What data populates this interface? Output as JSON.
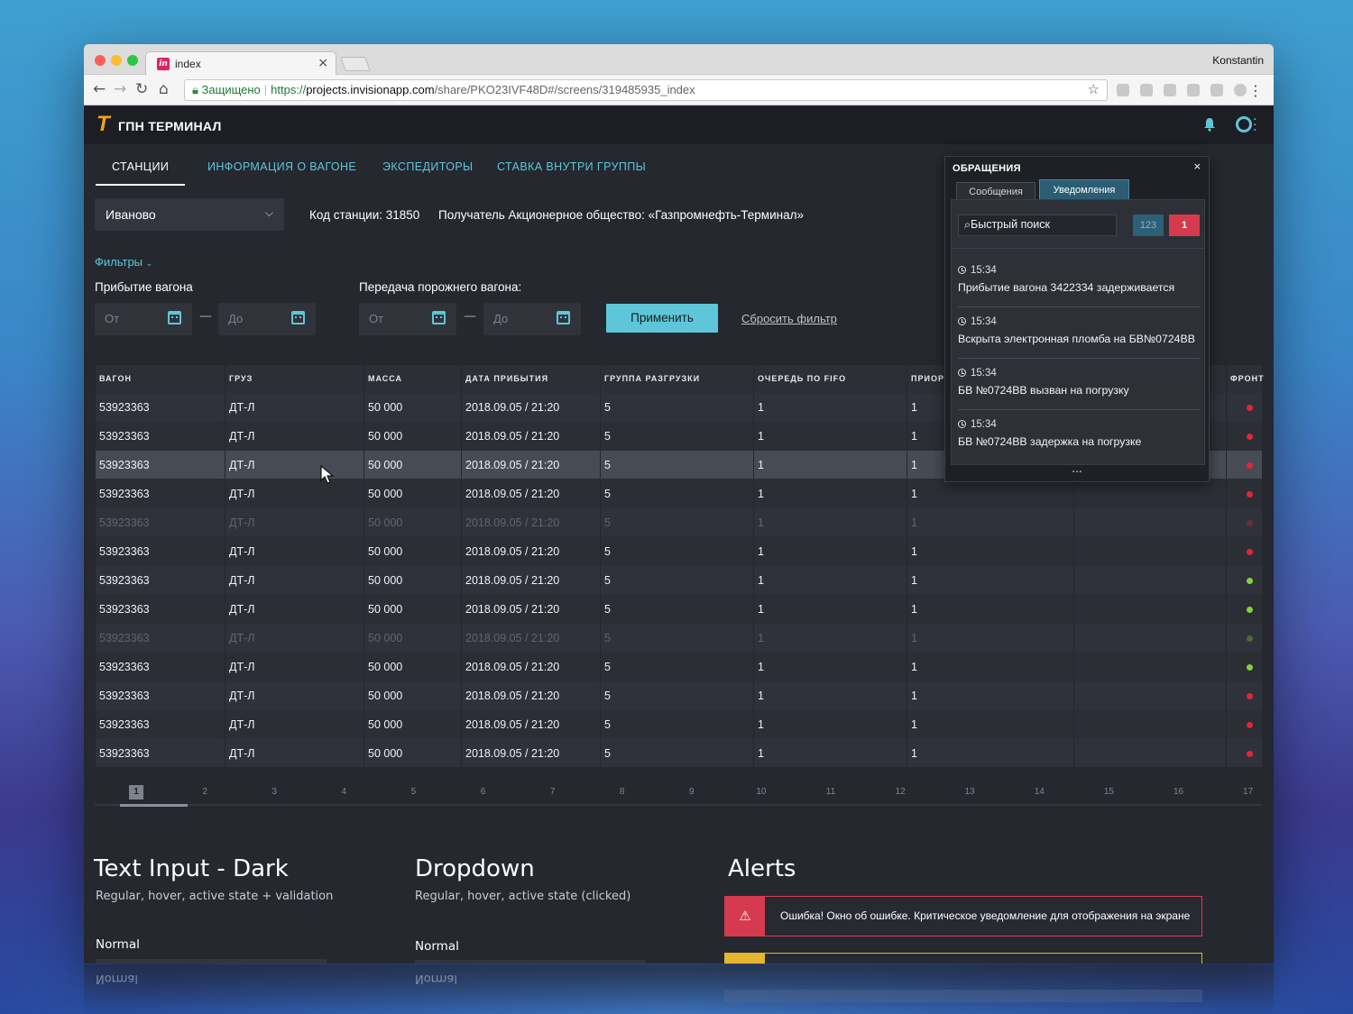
{
  "browser": {
    "tab_title": "index",
    "favicon_text": "in",
    "profile_name": "Konstantin",
    "url_secure_label": "Защищено",
    "url_protocol": "https://",
    "url_host": "projects.invisionapp.com",
    "url_path": "/share/PKO23IVF48D#/screens/319485935_index"
  },
  "header": {
    "logo_letter": "T",
    "brand": "ГПН ТЕРМИНАЛ"
  },
  "nav_tabs": [
    "СТАНЦИИ",
    "ИНФОРМАЦИЯ О ВАГОНЕ",
    "ЭКСПЕДИТОРЫ",
    "СТАВКА ВНУТРИ ГРУППЫ"
  ],
  "station": {
    "selected": "Иваново",
    "code_label": "Код станции: 31850",
    "receiver_label": "Получатель Акционерное общество: «Газпромнефть-Терминал»"
  },
  "filters": {
    "toggle": "Фильтры",
    "arrival_label": "Прибытие вагона",
    "transfer_label": "Передача порожнего вагона:",
    "from_placeholder": "От",
    "to_placeholder": "До",
    "apply": "Применить",
    "reset": "Сбросить фильтр"
  },
  "table": {
    "headers": [
      "ВАГОН",
      "ГРУЗ",
      "МАССА",
      "ДАТА ПРИБЫТИЯ",
      "ГРУППА РАЗГРУЗКИ",
      "ОЧЕРЕДЬ ПО FIFO",
      "ПРИОРИ",
      "",
      "ФРОНТ"
    ],
    "rows": [
      {
        "wagon": "53923363",
        "cargo": "ДТ-Л",
        "mass": "50 000",
        "date": "2018.09.05 / 21:20",
        "group": "5",
        "fifo": "1",
        "priority": "1",
        "status": "red",
        "style": "odd"
      },
      {
        "wagon": "53923363",
        "cargo": "ДТ-Л",
        "mass": "50 000",
        "date": "2018.09.05 / 21:20",
        "group": "5",
        "fifo": "1",
        "priority": "1",
        "status": "red",
        "style": "even"
      },
      {
        "wagon": "53923363",
        "cargo": "ДТ-Л",
        "mass": "50 000",
        "date": "2018.09.05 / 21:20",
        "group": "5",
        "fifo": "1",
        "priority": "1",
        "status": "red",
        "style": "hl"
      },
      {
        "wagon": "53923363",
        "cargo": "ДТ-Л",
        "mass": "50 000",
        "date": "2018.09.05 / 21:20",
        "group": "5",
        "fifo": "1",
        "priority": "1",
        "status": "red",
        "style": "even"
      },
      {
        "wagon": "53923363",
        "cargo": "ДТ-Л",
        "mass": "50 000",
        "date": "2018.09.05 / 21:20",
        "group": "5",
        "fifo": "1",
        "priority": "1",
        "status": "red",
        "style": "odd dim"
      },
      {
        "wagon": "53923363",
        "cargo": "ДТ-Л",
        "mass": "50 000",
        "date": "2018.09.05 / 21:20",
        "group": "5",
        "fifo": "1",
        "priority": "1",
        "status": "red",
        "style": "even"
      },
      {
        "wagon": "53923363",
        "cargo": "ДТ-Л",
        "mass": "50 000",
        "date": "2018.09.05 / 21:20",
        "group": "5",
        "fifo": "1",
        "priority": "1",
        "status": "green",
        "style": "odd"
      },
      {
        "wagon": "53923363",
        "cargo": "ДТ-Л",
        "mass": "50 000",
        "date": "2018.09.05 / 21:20",
        "group": "5",
        "fifo": "1",
        "priority": "1",
        "status": "green",
        "style": "even"
      },
      {
        "wagon": "53923363",
        "cargo": "ДТ-Л",
        "mass": "50 000",
        "date": "2018.09.05 / 21:20",
        "group": "5",
        "fifo": "1",
        "priority": "1",
        "status": "green",
        "style": "odd dim"
      },
      {
        "wagon": "53923363",
        "cargo": "ДТ-Л",
        "mass": "50 000",
        "date": "2018.09.05 / 21:20",
        "group": "5",
        "fifo": "1",
        "priority": "1",
        "status": "green",
        "style": "even"
      },
      {
        "wagon": "53923363",
        "cargo": "ДТ-Л",
        "mass": "50 000",
        "date": "2018.09.05 / 21:20",
        "group": "5",
        "fifo": "1",
        "priority": "1",
        "status": "red",
        "style": "odd"
      },
      {
        "wagon": "53923363",
        "cargo": "ДТ-Л",
        "mass": "50 000",
        "date": "2018.09.05 / 21:20",
        "group": "5",
        "fifo": "1",
        "priority": "1",
        "status": "red",
        "style": "even"
      },
      {
        "wagon": "53923363",
        "cargo": "ДТ-Л",
        "mass": "50 000",
        "date": "2018.09.05 / 21:20",
        "group": "5",
        "fifo": "1",
        "priority": "1",
        "status": "red",
        "style": "odd"
      }
    ]
  },
  "pagination": {
    "pages": [
      "1",
      "2",
      "3",
      "4",
      "5",
      "6",
      "7",
      "8",
      "9",
      "10",
      "11",
      "12",
      "13",
      "14",
      "15",
      "16",
      "17"
    ],
    "current": "1"
  },
  "styleguide": {
    "text_input_title": "Text Input - Dark",
    "text_input_sub": "Regular, hover, active state + validation",
    "text_input_label": "Normal",
    "dropdown_title": "Dropdown",
    "dropdown_sub": "Regular, hover, active state (clicked)",
    "dropdown_label": "Normal",
    "alerts_title": "Alerts",
    "alert_error_text": "Ошибка! Окно об ошибке. Критическое уведомление для отображения на экране"
  },
  "notifications_panel": {
    "title": "ОБРАЩЕНИЯ",
    "close": "×",
    "tabs": [
      "Сообщения",
      "Уведомления"
    ],
    "search_placeholder": "Быстрый поиск",
    "count_blue": "123",
    "count_red": "1",
    "more": "...",
    "items": [
      {
        "time": "15:34",
        "text": "Прибытие вагона 3422334 задерживается"
      },
      {
        "time": "15:34",
        "text": "Вскрыта электронная пломба на БВ№0724ВВ"
      },
      {
        "time": "15:34",
        "text": "БВ №0724ВВ вызван на погрузку"
      },
      {
        "time": "15:34",
        "text": "БВ №0724ВВ задержка на погрузке"
      }
    ]
  },
  "colors": {
    "accent": "#5fc6d9",
    "brand_orange": "#f2a317",
    "status_red": "#e0263a",
    "status_green": "#86d13a",
    "alert_error": "#d63a4e",
    "alert_warning": "#e6b531"
  }
}
